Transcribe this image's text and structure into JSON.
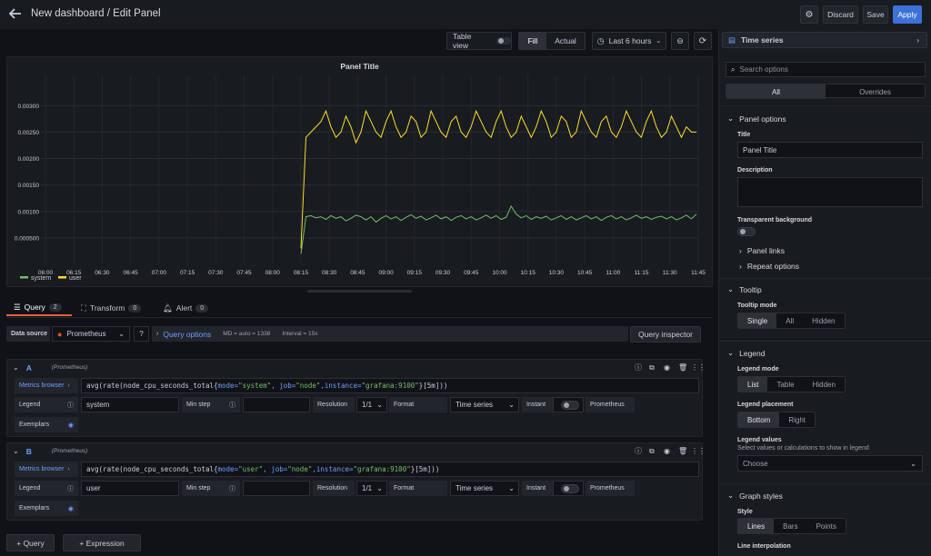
{
  "header": {
    "title": "New dashboard / Edit Panel",
    "discard_label": "Discard",
    "save_label": "Save",
    "apply_label": "Apply"
  },
  "toolbar": {
    "table_view_label": "Table view",
    "fill_label": "Fill",
    "actual_label": "Actual",
    "time_range": "Last 6 hours",
    "visualization": "Time series"
  },
  "panel": {
    "title": "Panel Title"
  },
  "chart_data": {
    "type": "line",
    "title": "Panel Title",
    "x_ticks": [
      "06:00",
      "06:15",
      "06:30",
      "06:45",
      "07:00",
      "07:15",
      "07:30",
      "07:45",
      "08:00",
      "08:15",
      "08:30",
      "08:45",
      "09:00",
      "09:15",
      "09:30",
      "09:45",
      "10:00",
      "10:15",
      "10:30",
      "10:45",
      "11:00",
      "11:15",
      "11:30",
      "11:45"
    ],
    "y_ticks": [
      "0.000500",
      "0.00100",
      "0.00150",
      "0.00200",
      "0.00250",
      "0.00300"
    ],
    "ylim": [
      0,
      0.0034
    ],
    "series": [
      {
        "name": "system",
        "color": "#73bf69",
        "start": "08:15",
        "values": [
          0.0002,
          0.0009,
          0.00092,
          0.00088,
          0.0009,
          0.00085,
          0.00092,
          0.00087,
          0.0009,
          0.00082,
          0.00087,
          0.00093,
          0.0009,
          0.00084,
          0.0009,
          0.0008,
          0.00087,
          0.00092,
          0.00086,
          0.0009,
          0.00083,
          0.00089,
          0.00094,
          0.00087,
          0.00091,
          0.00084,
          0.00088,
          0.00093,
          0.00086,
          0.0009,
          0.00083,
          0.00089,
          0.00092,
          0.00086,
          0.0009,
          0.00084,
          0.00088,
          0.00093,
          0.00087,
          0.00092,
          0.00085,
          0.00089,
          0.0011,
          0.00095,
          0.00088,
          0.00092,
          0.00085,
          0.0009,
          0.00087,
          0.00091,
          0.00084,
          0.00088,
          0.00092,
          0.00085,
          0.0009,
          0.00084,
          0.00088,
          0.00092,
          0.00086,
          0.0009,
          0.00083,
          0.00089,
          0.00092,
          0.00086,
          0.0009,
          0.00084,
          0.00088,
          0.00093,
          0.00087,
          0.0009,
          0.00085,
          0.00089,
          0.00091,
          0.00086,
          0.0009,
          0.00084,
          0.00088,
          0.00093,
          0.00086,
          0.00095
        ]
      },
      {
        "name": "user",
        "color": "#fade2a",
        "start": "08:15",
        "values": [
          0.0003,
          0.0024,
          0.0025,
          0.0026,
          0.0027,
          0.0029,
          0.0026,
          0.0024,
          0.0025,
          0.0028,
          0.0026,
          0.0023,
          0.0025,
          0.0029,
          0.0027,
          0.0025,
          0.0024,
          0.0027,
          0.0029,
          0.0026,
          0.0024,
          0.0025,
          0.0028,
          0.0027,
          0.0024,
          0.0025,
          0.0029,
          0.0027,
          0.0025,
          0.0024,
          0.0027,
          0.0028,
          0.0025,
          0.0024,
          0.0026,
          0.0029,
          0.0027,
          0.0025,
          0.0024,
          0.0027,
          0.0029,
          0.0026,
          0.0024,
          0.0025,
          0.0028,
          0.0026,
          0.0024,
          0.0026,
          0.0029,
          0.0027,
          0.0024,
          0.0025,
          0.0028,
          0.0027,
          0.0024,
          0.0025,
          0.0029,
          0.0027,
          0.0025,
          0.0024,
          0.0027,
          0.0028,
          0.0025,
          0.0024,
          0.0026,
          0.0029,
          0.0027,
          0.0025,
          0.0024,
          0.0027,
          0.0029,
          0.0026,
          0.0024,
          0.0025,
          0.0028,
          0.0026,
          0.0024,
          0.0026,
          0.0025,
          0.0025
        ]
      }
    ],
    "legend": "bottom-left",
    "grid": true
  },
  "tabs": {
    "query_label": "Query",
    "query_count": "2",
    "transform_label": "Transform",
    "transform_count": "0",
    "alert_label": "Alert",
    "alert_count": "0"
  },
  "datasource": {
    "label": "Data source",
    "value": "Prometheus",
    "query_options_label": "Query options",
    "md": "MD = auto = 1338",
    "interval": "Interval = 15x",
    "inspector_label": "Query inspector"
  },
  "queries": [
    {
      "letter": "A",
      "source": "(Prometheus)",
      "metrics_browser": "Metrics browser",
      "expr_fn": "avg(rate(node_cpu_seconds_total{",
      "expr_k1": "mode=",
      "expr_v1": "\"system\"",
      "expr_k2": ", job=",
      "expr_v2": "\"node\"",
      "expr_k3": ",instance=",
      "expr_v3": "\"grafana:9100\"",
      "expr_end": "}[5m]))",
      "legend_label": "Legend",
      "legend_value": "system",
      "min_step_label": "Min step",
      "resolution_label": "Resolution",
      "resolution_value": "1/1",
      "format_label": "Format",
      "format_value": "Time series",
      "instant_label": "Instant",
      "prometheus_label": "Prometheus",
      "exemplars_label": "Exemplars"
    },
    {
      "letter": "B",
      "source": "(Prometheus)",
      "metrics_browser": "Metrics browser",
      "expr_fn": "avg(rate(node_cpu_seconds_total{",
      "expr_k1": "mode=",
      "expr_v1": "\"user\"",
      "expr_k2": ", job=",
      "expr_v2": "\"node\"",
      "expr_k3": ",instance=",
      "expr_v3": "\"grafana:9100\"",
      "expr_end": "}[5m]))",
      "legend_label": "Legend",
      "legend_value": "user",
      "min_step_label": "Min step",
      "resolution_label": "Resolution",
      "resolution_value": "1/1",
      "format_label": "Format",
      "format_value": "Time series",
      "instant_label": "Instant",
      "prometheus_label": "Prometheus",
      "exemplars_label": "Exemplars"
    }
  ],
  "footer": {
    "add_query": "+ Query",
    "add_expression": "+ Expression"
  },
  "options": {
    "search_placeholder": "Search options",
    "all_label": "All",
    "overrides_label": "Overrides",
    "panel_options": "Panel options",
    "title_label": "Title",
    "title_value": "Panel Title",
    "description_label": "Description",
    "transparent_label": "Transparent background",
    "panel_links": "Panel links",
    "repeat_options": "Repeat options",
    "tooltip": "Tooltip",
    "tooltip_mode": "Tooltip mode",
    "tooltip_single": "Single",
    "tooltip_all": "All",
    "tooltip_hidden": "Hidden",
    "legend": "Legend",
    "legend_mode": "Legend mode",
    "legend_list": "List",
    "legend_table": "Table",
    "legend_hidden": "Hidden",
    "legend_placement": "Legend placement",
    "placement_bottom": "Bottom",
    "placement_right": "Right",
    "legend_values": "Legend values",
    "legend_values_desc": "Select values or calculations to show in legend",
    "choose": "Choose",
    "graph_styles": "Graph styles",
    "style": "Style",
    "style_lines": "Lines",
    "style_bars": "Bars",
    "style_points": "Points",
    "line_interpolation": "Line interpolation"
  }
}
